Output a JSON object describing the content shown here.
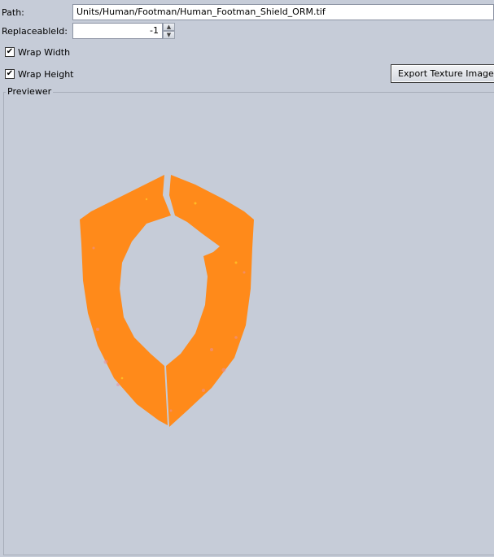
{
  "path": {
    "label": "Path:",
    "value": "Units/Human/Footman/Human_Footman_Shield_ORM.tif"
  },
  "replaceable_id": {
    "label": "ReplaceableId:",
    "value": "-1"
  },
  "wrap_width": {
    "label": "Wrap Width",
    "checked": true
  },
  "wrap_height": {
    "label": "Wrap Height",
    "checked": true
  },
  "export_button": {
    "label": "Export Texture Image File"
  },
  "previewer": {
    "title": "Previewer",
    "texture_color": "#ff8a1a"
  },
  "colors": {
    "background": "#c6ccd8",
    "texture_orange": "#ff8a1a",
    "texture_highlight": "#e890a0"
  }
}
